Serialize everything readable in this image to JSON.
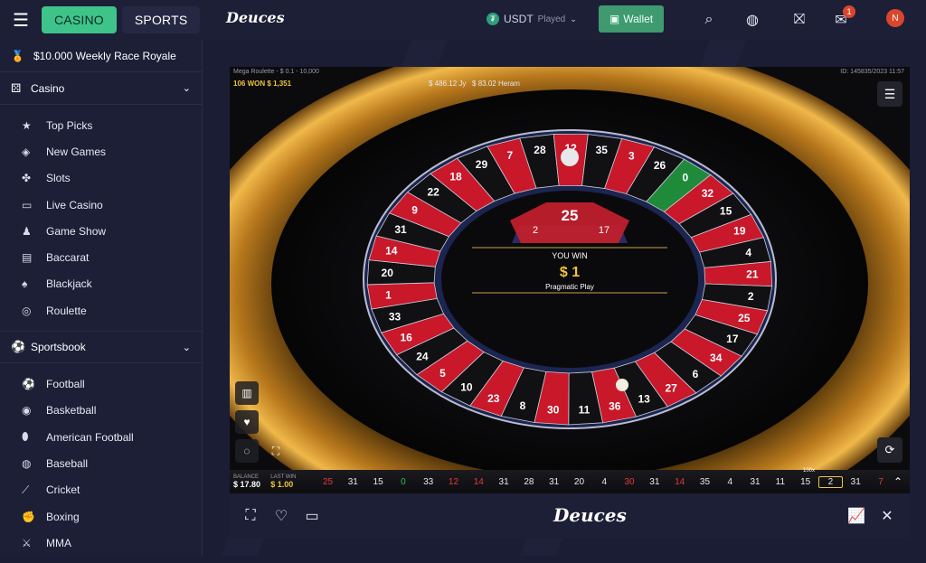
{
  "topbar": {
    "casino": "CASINO",
    "sports": "SPORTS",
    "logo": "Deuces",
    "currency": "USDT",
    "currency_state": "Played",
    "wallet": "Wallet",
    "notifications": "1",
    "avatar": "N"
  },
  "sidebar": {
    "race": "$10.000 Weekly Race Royale",
    "casino_section": "Casino",
    "casino_items": [
      {
        "label": "Top Picks",
        "icon": "star-icon"
      },
      {
        "label": "New Games",
        "icon": "tag-icon"
      },
      {
        "label": "Slots",
        "icon": "slots-icon"
      },
      {
        "label": "Live Casino",
        "icon": "tv-icon"
      },
      {
        "label": "Game Show",
        "icon": "game-show-icon"
      },
      {
        "label": "Baccarat",
        "icon": "cards-icon"
      },
      {
        "label": "Blackjack",
        "icon": "spade-icon"
      },
      {
        "label": "Roulette",
        "icon": "roulette-icon"
      }
    ],
    "sportsbook_section": "Sportsbook",
    "sports_items": [
      {
        "label": "Football",
        "icon": "football-icon"
      },
      {
        "label": "Basketball",
        "icon": "basketball-icon"
      },
      {
        "label": "American Football",
        "icon": "american-football-icon"
      },
      {
        "label": "Baseball",
        "icon": "baseball-icon"
      },
      {
        "label": "Cricket",
        "icon": "cricket-icon"
      },
      {
        "label": "Boxing",
        "icon": "boxing-icon"
      },
      {
        "label": "MMA",
        "icon": "mma-icon"
      }
    ]
  },
  "game": {
    "table_name": "Mega Roulette - $ 0.1 - 10,000",
    "game_id": "ID: 145835/2023 11:57",
    "won_count": "106",
    "won_label": "WON",
    "won_amount": "$ 1,351",
    "player1": "$ 486.12 Jy",
    "player2": "$ 83.02 Heram",
    "result_number": "25",
    "multiplier_left": "2",
    "multiplier_right": "17",
    "you_win": "YOU WIN",
    "win_amount": "$ 1",
    "provider": "Pragmatic Play",
    "balance_label": "BALANCE",
    "balance": "$ 17.80",
    "last_win_label": "LAST WIN",
    "last_win": "$ 1.00",
    "history": [
      {
        "n": "25",
        "c": "red"
      },
      {
        "n": "31",
        "c": "blk"
      },
      {
        "n": "15",
        "c": "blk"
      },
      {
        "n": "0",
        "c": "grn"
      },
      {
        "n": "33",
        "c": "blk"
      },
      {
        "n": "12",
        "c": "red"
      },
      {
        "n": "14",
        "c": "red"
      },
      {
        "n": "31",
        "c": "blk"
      },
      {
        "n": "28",
        "c": "blk"
      },
      {
        "n": "31",
        "c": "blk"
      },
      {
        "n": "20",
        "c": "blk"
      },
      {
        "n": "4",
        "c": "blk"
      },
      {
        "n": "30",
        "c": "red"
      },
      {
        "n": "31",
        "c": "blk"
      },
      {
        "n": "14",
        "c": "red"
      },
      {
        "n": "35",
        "c": "blk"
      },
      {
        "n": "4",
        "c": "blk"
      },
      {
        "n": "31",
        "c": "blk"
      },
      {
        "n": "11",
        "c": "blk"
      },
      {
        "n": "15",
        "c": "blk"
      },
      {
        "n": "2",
        "c": "blk"
      },
      {
        "n": "31",
        "c": "blk"
      },
      {
        "n": "7",
        "c": "red"
      }
    ],
    "boxed_multiplier": "100x",
    "wheel_numbers": [
      "0",
      "32",
      "15",
      "19",
      "4",
      "21",
      "2",
      "25",
      "17",
      "34",
      "6",
      "27",
      "13",
      "36",
      "11",
      "30",
      "8",
      "23",
      "10",
      "5",
      "24",
      "16",
      "33",
      "1",
      "20",
      "14",
      "31",
      "9",
      "22",
      "18",
      "29",
      "7",
      "28",
      "12",
      "35",
      "3",
      "26"
    ],
    "colors": {
      "red": "#c8182a",
      "black": "#111114",
      "green": "#1f8a3a",
      "gold": "#d9a437"
    }
  },
  "toolbar": {
    "logo": "Deuces"
  }
}
